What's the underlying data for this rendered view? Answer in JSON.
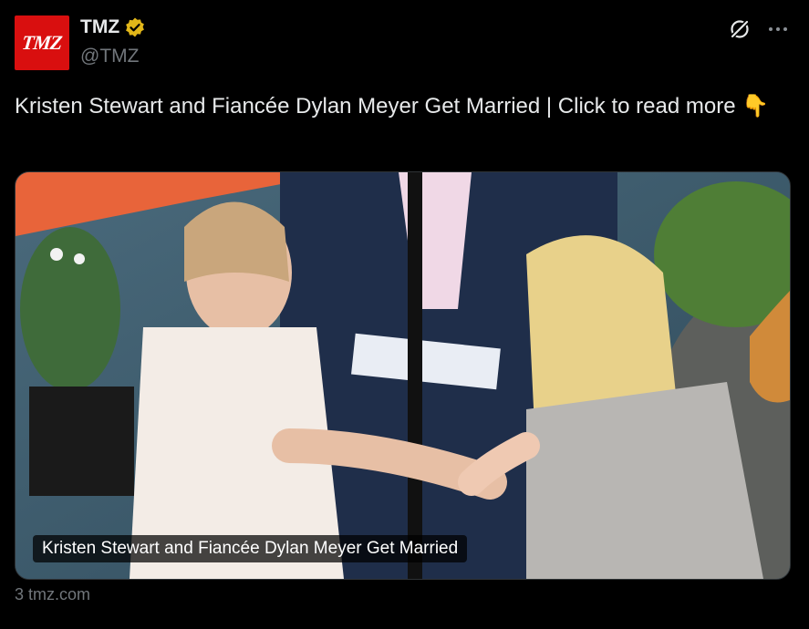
{
  "author": {
    "avatar_text": "TMZ",
    "display_name": "TMZ",
    "handle": "@TMZ",
    "verified_color": "#e2b719"
  },
  "tweet": {
    "text": "Kristen Stewart and Fiancée Dylan Meyer Get Married   |  Click to read more 👇"
  },
  "card": {
    "caption": "Kristen Stewart and Fiancée Dylan Meyer Get Married",
    "source": "3 tmz.com"
  },
  "icons": {
    "grok": "grok-icon",
    "more": "more-icon",
    "verified": "verified-badge-icon"
  },
  "colors": {
    "background": "#000000",
    "text_primary": "#e7e9ea",
    "text_secondary": "#71767b",
    "brand_red": "#d90f0f"
  }
}
